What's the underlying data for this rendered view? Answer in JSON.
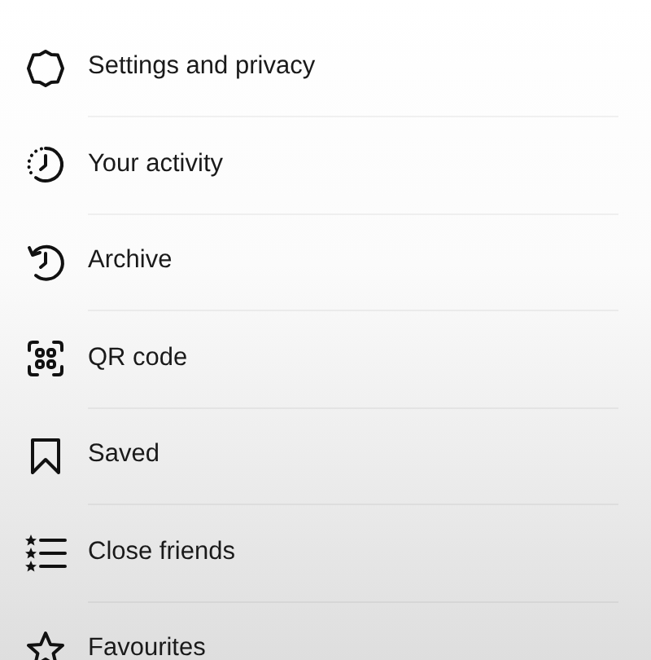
{
  "menu": [
    {
      "kind": "settings",
      "label": "Settings and privacy"
    },
    {
      "kind": "activity",
      "label": "Your activity"
    },
    {
      "kind": "archive",
      "label": "Archive"
    },
    {
      "kind": "qr",
      "label": "QR code"
    },
    {
      "kind": "saved",
      "label": "Saved"
    },
    {
      "kind": "friends",
      "label": "Close friends"
    },
    {
      "kind": "star",
      "label": "Favourites"
    }
  ]
}
